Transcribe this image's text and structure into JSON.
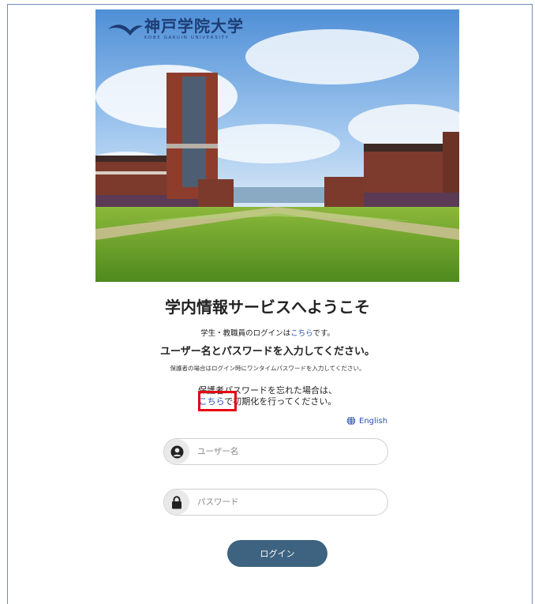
{
  "logo": {
    "name_jp": "神戸学院大学",
    "name_en": "KOBE GAKUIN UNIVERSITY"
  },
  "page": {
    "title": "学内情報サービスへようこそ",
    "staff_login_prefix": "学生・教職員のログインは",
    "staff_login_link": "こちら",
    "staff_login_suffix": "です。",
    "instruction": "ユーザー名とパスワードを入力してください。",
    "guardian_note": "保護者の場合はログイン時にワンタイムパスワードを入力してください。",
    "forgot_line1": "保護者パスワードを忘れた場合は、",
    "forgot_link": "こちら",
    "forgot_suffix": "で初期化を行ってください。"
  },
  "language": {
    "label": "English",
    "icon": "globe-icon"
  },
  "form": {
    "username_placeholder": "ユーザー名",
    "username_icon": "user-circle-icon",
    "password_placeholder": "パスワード",
    "password_icon": "lock-icon",
    "login_label": "ログイン"
  },
  "colors": {
    "link": "#2b4fb3",
    "button": "#3d6380",
    "highlight": "#e50012"
  }
}
